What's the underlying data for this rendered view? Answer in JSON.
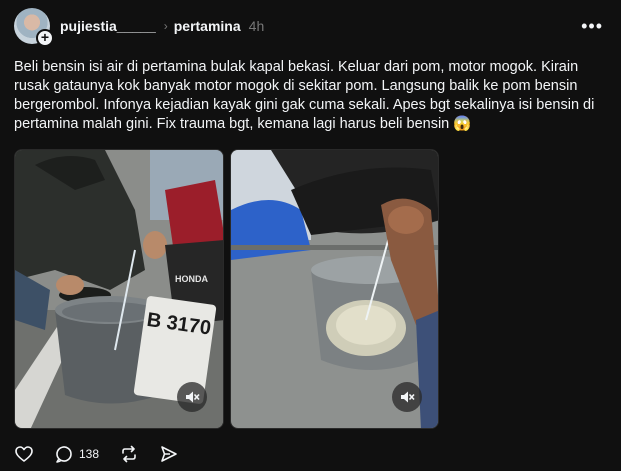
{
  "post": {
    "username": "pujiestia_____",
    "community": "pertamina",
    "time": "4h",
    "text": "Beli bensin isi air di pertamina bulak kapal bekasi. Keluar dari pom, motor mogok. Kirain rusak gataunya kok banyak motor mogok di sekitar pom. Langsung balik ke pom bensin bergerombol. Infonya kejadian kayak gini gak cuma sekali. Apes bgt sekalinya isi bensin di pertamina malah gini. Fix trauma bgt, kemana lagi harus beli bensin 😱",
    "media": [
      {
        "plate_text": "B 3170",
        "badge_text": "HONDA"
      },
      {
        "badge_text": ""
      }
    ]
  },
  "actions": {
    "reply_count": "138"
  },
  "icons": {
    "like": "heart-icon",
    "reply": "comment-icon",
    "repost": "repost-icon",
    "share": "send-icon",
    "more": "more-dots-icon",
    "mute": "muted-speaker-icon",
    "follow": "plus-icon"
  },
  "colors": {
    "background": "#101010",
    "text": "#f3f5f7",
    "muted": "#777777"
  }
}
